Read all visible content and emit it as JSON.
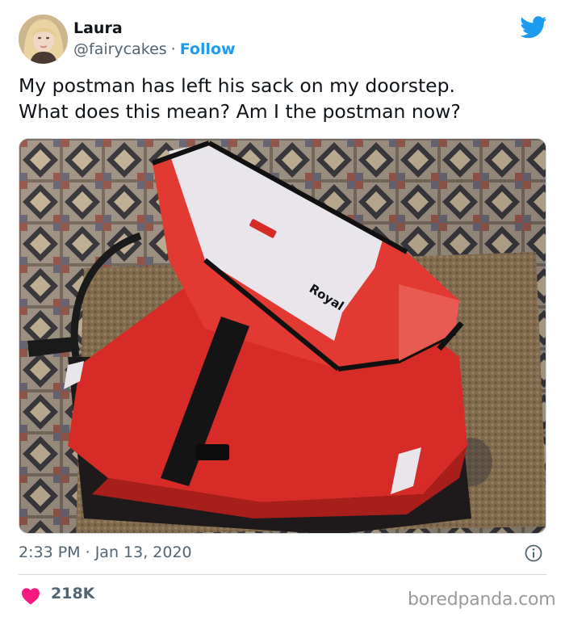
{
  "author": {
    "name": "Laura",
    "handle": "@fairycakes",
    "separator": "·",
    "follow_label": "Follow"
  },
  "tweet": {
    "lines": [
      "My postman has left his sack on my doorstep.",
      "What does this mean? Am I the postman now?"
    ],
    "photo_label": "Royal"
  },
  "meta": {
    "time": "2:33 PM",
    "separator": "·",
    "date": "Jan 13, 2020"
  },
  "engagement": {
    "likes": "218K"
  },
  "watermark": "boredpanda.com",
  "colors": {
    "accent": "#1d9bf0",
    "like": "#f91880",
    "muted": "#536471",
    "text": "#0f1419"
  },
  "icons": [
    "twitter-bird-icon",
    "info-icon",
    "heart-icon"
  ]
}
